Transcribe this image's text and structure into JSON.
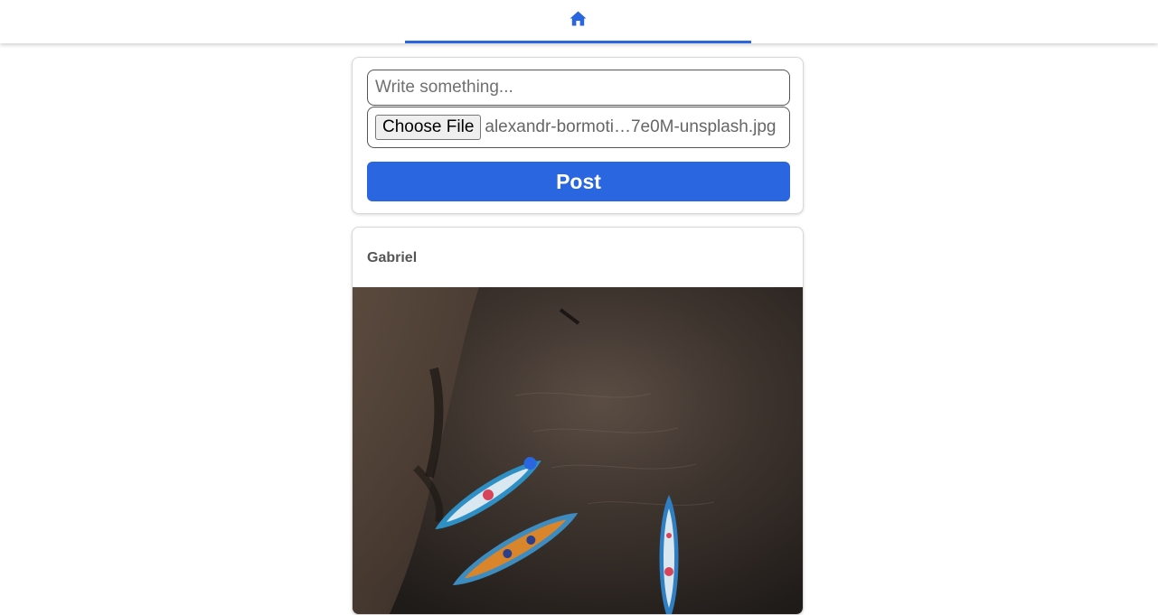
{
  "nav": {
    "home_icon": "home-icon",
    "accent": "#2a66e0"
  },
  "composer": {
    "placeholder": "Write something...",
    "file_button_label": "Choose File",
    "file_name": "alexandr-bormoti…7e0M-unsplash.jpg",
    "post_label": "Post"
  },
  "posts": [
    {
      "author": "Gabriel",
      "image": "boats-on-river-photo"
    }
  ]
}
